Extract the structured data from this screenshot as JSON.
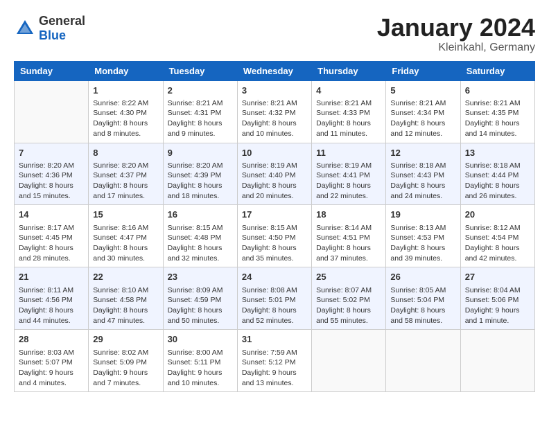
{
  "header": {
    "logo_general": "General",
    "logo_blue": "Blue",
    "month_title": "January 2024",
    "location": "Kleinkahl, Germany"
  },
  "weekdays": [
    "Sunday",
    "Monday",
    "Tuesday",
    "Wednesday",
    "Thursday",
    "Friday",
    "Saturday"
  ],
  "weeks": [
    [
      {
        "day": "",
        "sunrise": "",
        "sunset": "",
        "daylight": ""
      },
      {
        "day": "1",
        "sunrise": "Sunrise: 8:22 AM",
        "sunset": "Sunset: 4:30 PM",
        "daylight": "Daylight: 8 hours and 8 minutes."
      },
      {
        "day": "2",
        "sunrise": "Sunrise: 8:21 AM",
        "sunset": "Sunset: 4:31 PM",
        "daylight": "Daylight: 8 hours and 9 minutes."
      },
      {
        "day": "3",
        "sunrise": "Sunrise: 8:21 AM",
        "sunset": "Sunset: 4:32 PM",
        "daylight": "Daylight: 8 hours and 10 minutes."
      },
      {
        "day": "4",
        "sunrise": "Sunrise: 8:21 AM",
        "sunset": "Sunset: 4:33 PM",
        "daylight": "Daylight: 8 hours and 11 minutes."
      },
      {
        "day": "5",
        "sunrise": "Sunrise: 8:21 AM",
        "sunset": "Sunset: 4:34 PM",
        "daylight": "Daylight: 8 hours and 12 minutes."
      },
      {
        "day": "6",
        "sunrise": "Sunrise: 8:21 AM",
        "sunset": "Sunset: 4:35 PM",
        "daylight": "Daylight: 8 hours and 14 minutes."
      }
    ],
    [
      {
        "day": "7",
        "sunrise": "Sunrise: 8:20 AM",
        "sunset": "Sunset: 4:36 PM",
        "daylight": "Daylight: 8 hours and 15 minutes."
      },
      {
        "day": "8",
        "sunrise": "Sunrise: 8:20 AM",
        "sunset": "Sunset: 4:37 PM",
        "daylight": "Daylight: 8 hours and 17 minutes."
      },
      {
        "day": "9",
        "sunrise": "Sunrise: 8:20 AM",
        "sunset": "Sunset: 4:39 PM",
        "daylight": "Daylight: 8 hours and 18 minutes."
      },
      {
        "day": "10",
        "sunrise": "Sunrise: 8:19 AM",
        "sunset": "Sunset: 4:40 PM",
        "daylight": "Daylight: 8 hours and 20 minutes."
      },
      {
        "day": "11",
        "sunrise": "Sunrise: 8:19 AM",
        "sunset": "Sunset: 4:41 PM",
        "daylight": "Daylight: 8 hours and 22 minutes."
      },
      {
        "day": "12",
        "sunrise": "Sunrise: 8:18 AM",
        "sunset": "Sunset: 4:43 PM",
        "daylight": "Daylight: 8 hours and 24 minutes."
      },
      {
        "day": "13",
        "sunrise": "Sunrise: 8:18 AM",
        "sunset": "Sunset: 4:44 PM",
        "daylight": "Daylight: 8 hours and 26 minutes."
      }
    ],
    [
      {
        "day": "14",
        "sunrise": "Sunrise: 8:17 AM",
        "sunset": "Sunset: 4:45 PM",
        "daylight": "Daylight: 8 hours and 28 minutes."
      },
      {
        "day": "15",
        "sunrise": "Sunrise: 8:16 AM",
        "sunset": "Sunset: 4:47 PM",
        "daylight": "Daylight: 8 hours and 30 minutes."
      },
      {
        "day": "16",
        "sunrise": "Sunrise: 8:15 AM",
        "sunset": "Sunset: 4:48 PM",
        "daylight": "Daylight: 8 hours and 32 minutes."
      },
      {
        "day": "17",
        "sunrise": "Sunrise: 8:15 AM",
        "sunset": "Sunset: 4:50 PM",
        "daylight": "Daylight: 8 hours and 35 minutes."
      },
      {
        "day": "18",
        "sunrise": "Sunrise: 8:14 AM",
        "sunset": "Sunset: 4:51 PM",
        "daylight": "Daylight: 8 hours and 37 minutes."
      },
      {
        "day": "19",
        "sunrise": "Sunrise: 8:13 AM",
        "sunset": "Sunset: 4:53 PM",
        "daylight": "Daylight: 8 hours and 39 minutes."
      },
      {
        "day": "20",
        "sunrise": "Sunrise: 8:12 AM",
        "sunset": "Sunset: 4:54 PM",
        "daylight": "Daylight: 8 hours and 42 minutes."
      }
    ],
    [
      {
        "day": "21",
        "sunrise": "Sunrise: 8:11 AM",
        "sunset": "Sunset: 4:56 PM",
        "daylight": "Daylight: 8 hours and 44 minutes."
      },
      {
        "day": "22",
        "sunrise": "Sunrise: 8:10 AM",
        "sunset": "Sunset: 4:58 PM",
        "daylight": "Daylight: 8 hours and 47 minutes."
      },
      {
        "day": "23",
        "sunrise": "Sunrise: 8:09 AM",
        "sunset": "Sunset: 4:59 PM",
        "daylight": "Daylight: 8 hours and 50 minutes."
      },
      {
        "day": "24",
        "sunrise": "Sunrise: 8:08 AM",
        "sunset": "Sunset: 5:01 PM",
        "daylight": "Daylight: 8 hours and 52 minutes."
      },
      {
        "day": "25",
        "sunrise": "Sunrise: 8:07 AM",
        "sunset": "Sunset: 5:02 PM",
        "daylight": "Daylight: 8 hours and 55 minutes."
      },
      {
        "day": "26",
        "sunrise": "Sunrise: 8:05 AM",
        "sunset": "Sunset: 5:04 PM",
        "daylight": "Daylight: 8 hours and 58 minutes."
      },
      {
        "day": "27",
        "sunrise": "Sunrise: 8:04 AM",
        "sunset": "Sunset: 5:06 PM",
        "daylight": "Daylight: 9 hours and 1 minute."
      }
    ],
    [
      {
        "day": "28",
        "sunrise": "Sunrise: 8:03 AM",
        "sunset": "Sunset: 5:07 PM",
        "daylight": "Daylight: 9 hours and 4 minutes."
      },
      {
        "day": "29",
        "sunrise": "Sunrise: 8:02 AM",
        "sunset": "Sunset: 5:09 PM",
        "daylight": "Daylight: 9 hours and 7 minutes."
      },
      {
        "day": "30",
        "sunrise": "Sunrise: 8:00 AM",
        "sunset": "Sunset: 5:11 PM",
        "daylight": "Daylight: 9 hours and 10 minutes."
      },
      {
        "day": "31",
        "sunrise": "Sunrise: 7:59 AM",
        "sunset": "Sunset: 5:12 PM",
        "daylight": "Daylight: 9 hours and 13 minutes."
      },
      {
        "day": "",
        "sunrise": "",
        "sunset": "",
        "daylight": ""
      },
      {
        "day": "",
        "sunrise": "",
        "sunset": "",
        "daylight": ""
      },
      {
        "day": "",
        "sunrise": "",
        "sunset": "",
        "daylight": ""
      }
    ]
  ]
}
